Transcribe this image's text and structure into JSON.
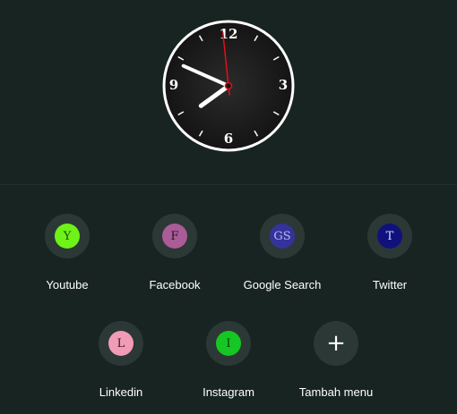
{
  "clock": {
    "numerals": {
      "top": "12",
      "right": "3",
      "bottom": "6",
      "left": "9"
    },
    "time": {
      "hour": 7,
      "minute": 48,
      "second": 59
    },
    "colors": {
      "face": "#1b1b1b",
      "rim": "#ffffff",
      "hands": "#ffffff",
      "second_hand": "#e0111b"
    }
  },
  "shortcuts": [
    {
      "letter": "Y",
      "label": "Youtube",
      "badge_bg": "#6ff217",
      "badge_fg": "#1e4a12"
    },
    {
      "letter": "F",
      "label": "Facebook",
      "badge_bg": "#a95c97",
      "badge_fg": "#2b1227"
    },
    {
      "letter": "GS",
      "label": "Google Search",
      "badge_bg": "#34339c",
      "badge_fg": "#b9b9ee"
    },
    {
      "letter": "T",
      "label": "Twitter",
      "badge_bg": "#11117e",
      "badge_fg": "#d8d8ff"
    },
    {
      "letter": "L",
      "label": "Linkedin",
      "badge_bg": "#f19bb6",
      "badge_fg": "#3a1722"
    },
    {
      "letter": "I",
      "label": "Instagram",
      "badge_bg": "#16c623",
      "badge_fg": "#07400c"
    }
  ],
  "add_shortcut": {
    "icon": "plus-icon",
    "label": "Tambah menu"
  }
}
